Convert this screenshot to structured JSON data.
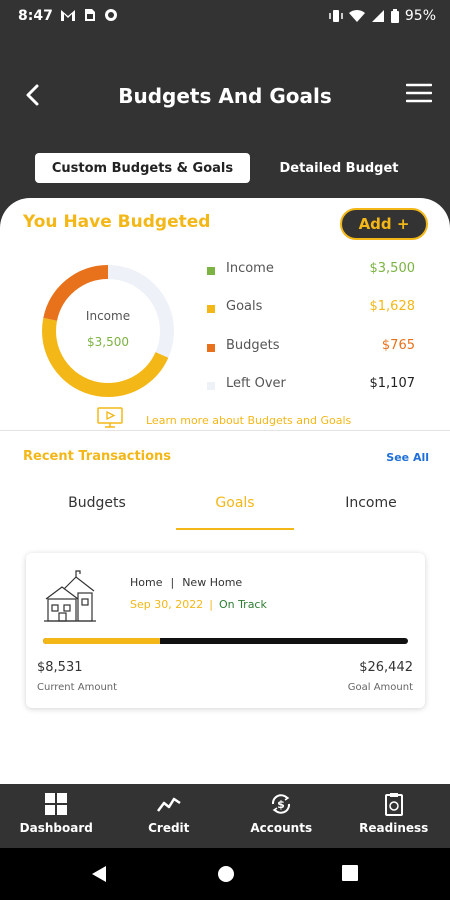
{
  "status_bar": {
    "time": "8:47",
    "battery": "95%"
  },
  "header": {
    "title": "Budgets And Goals",
    "tabs": [
      {
        "label": "Custom Budgets & Goals",
        "active": true
      },
      {
        "label": "Detailed Budget",
        "active": false
      }
    ]
  },
  "budget": {
    "title": "You Have Budgeted",
    "add_label": "Add +",
    "donut_center_label": "Income",
    "donut_center_value": "$3,500",
    "legend": [
      {
        "label": "Income",
        "value": "$3,500",
        "color": "#7cb342",
        "value_color": "#7cb342"
      },
      {
        "label": "Goals",
        "value": "$1,628",
        "color": "#f3b717",
        "value_color": "#f3b717"
      },
      {
        "label": "Budgets",
        "value": "$765",
        "color": "#e8711c",
        "value_color": "#e8711c"
      },
      {
        "label": "Left Over",
        "value": "$1,107",
        "color": "#eef1f7",
        "value_color": "#222222"
      }
    ],
    "learn_more": "Learn more about Budgets and Goals"
  },
  "transactions": {
    "title": "Recent Transactions",
    "see_all": "See All",
    "tabs": [
      {
        "label": "Budgets",
        "active": false
      },
      {
        "label": "Goals",
        "active": true
      },
      {
        "label": "Income",
        "active": false
      }
    ]
  },
  "goal": {
    "category": "Home",
    "name": "New Home",
    "date": "Sep 30, 2022",
    "status": "On Track",
    "progress_fraction": 0.32,
    "current_amount": "$8,531",
    "goal_amount": "$26,442",
    "current_label": "Current Amount",
    "goal_label": "Goal Amount"
  },
  "bottom_nav": [
    {
      "label": "Dashboard",
      "icon": "dashboard-icon"
    },
    {
      "label": "Credit",
      "icon": "credit-icon"
    },
    {
      "label": "Accounts",
      "icon": "accounts-icon"
    },
    {
      "label": "Readiness",
      "icon": "readiness-icon"
    }
  ],
  "colors": {
    "accent": "#f3b717",
    "income": "#7cb342",
    "budgets": "#e8711c",
    "leftover": "#eef1f7",
    "link": "#1e6fd9",
    "status_ok": "#2e7d32",
    "dark": "#333333"
  }
}
